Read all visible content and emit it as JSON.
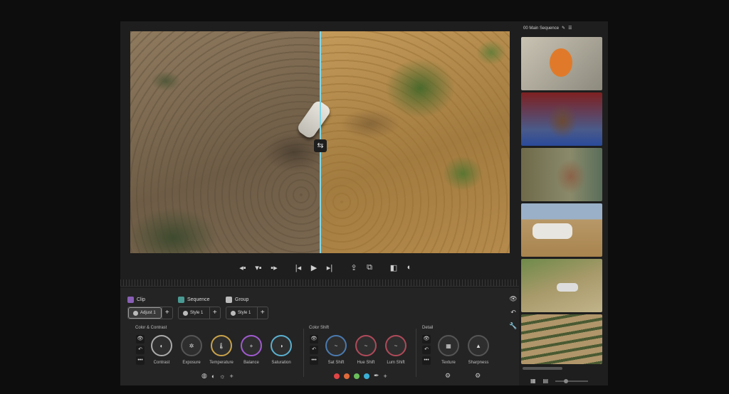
{
  "sequence": {
    "title": "00 Main Sequence"
  },
  "viewer": {
    "compare_handle": "⇆"
  },
  "transport": {
    "buttons": [
      "◂▪",
      "▾▪",
      "▪▸",
      "|◂",
      "▶",
      "▸|",
      "⇪",
      "⧉",
      "◧",
      "◐"
    ]
  },
  "tabs": {
    "clip": {
      "label": "Clip",
      "chip": "Adjust 1",
      "color": "#b58ad6"
    },
    "sequence": {
      "label": "Sequence",
      "chip": "Style 1",
      "color": "#5fb6b0"
    },
    "group": {
      "label": "Group",
      "chip": "Style 1",
      "color": "#cfcfcf"
    }
  },
  "sections": {
    "color_contrast": {
      "title": "Color & Contrast",
      "knobs": [
        "Contrast",
        "Exposure",
        "Temperature",
        "Balance",
        "Saturation"
      ]
    },
    "color_shift": {
      "title": "Color Shift",
      "knobs": [
        "Sat Shift",
        "Hue Shift",
        "Lum Shift"
      ]
    },
    "detail": {
      "title": "Detail",
      "knobs": [
        "Texture",
        "Sharpness"
      ]
    }
  },
  "color_dots": [
    "#e04444",
    "#e06a3a",
    "#6ac05a",
    "#3ab0d8"
  ],
  "icons": {
    "eye": "👁",
    "undo": "↶",
    "more": "•••",
    "plus": "+",
    "edit": "✎",
    "settings": "☰"
  }
}
